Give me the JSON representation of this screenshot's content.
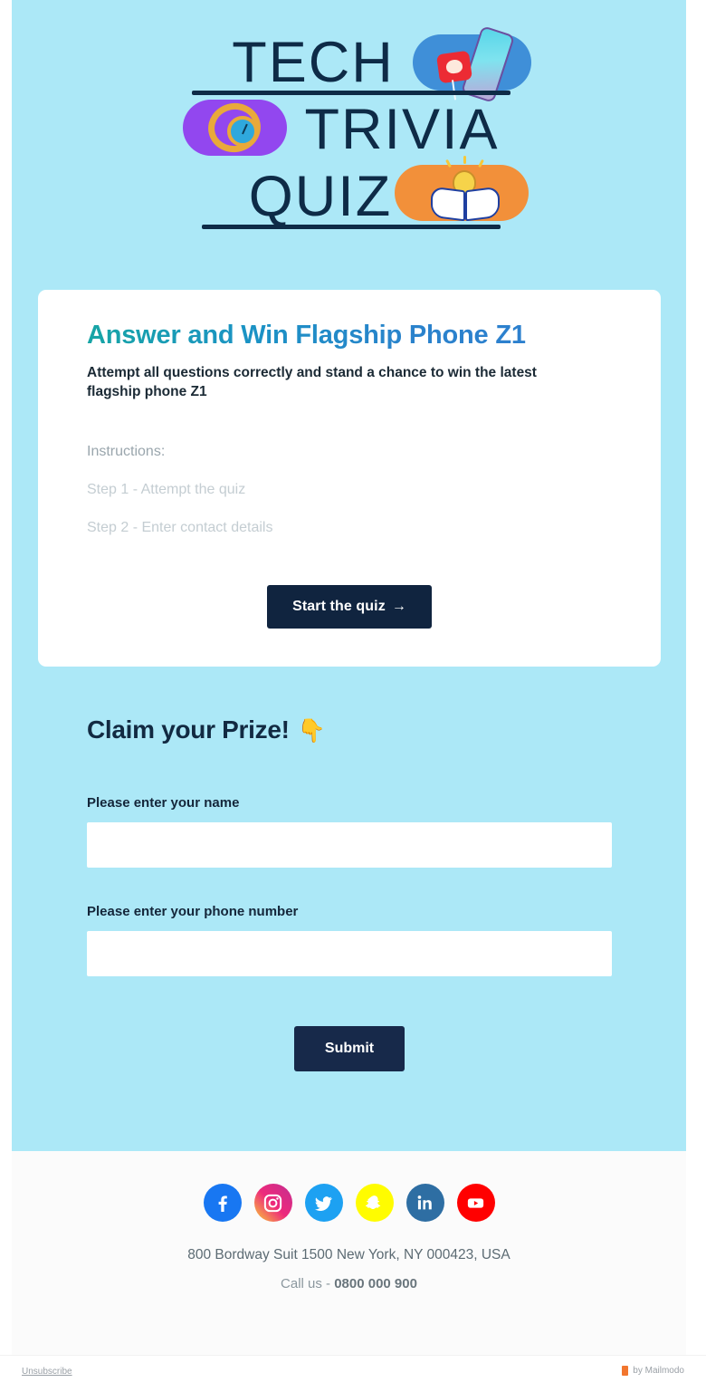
{
  "brand": {
    "logo_line_1": "TECH",
    "logo_line_2": "TRIVIA",
    "logo_line_3": "QUIZ",
    "logo_colors": {
      "text": "#0e2b47",
      "pill_phone": "#3f8fd8",
      "pill_watch": "#9247ef",
      "pill_book": "#f2903a"
    }
  },
  "theme": {
    "page_background": "#ace8f7",
    "card_background": "#ffffff",
    "accent_button": "#10243f",
    "heading_gradient_from": "#17a5a5",
    "heading_gradient_to": "#2f7fd0",
    "footer_background": "#fbfbfb"
  },
  "card": {
    "title": "Answer and Win Flagship Phone Z1",
    "subtitle": "Attempt all questions correctly and stand a chance to win the latest flagship phone Z1",
    "instructions_label": "Instructions:",
    "steps": [
      "Step 1 - Attempt the quiz",
      "Step 2 - Enter contact details"
    ],
    "cta_label": "Start the quiz",
    "cta_arrow": "→"
  },
  "claim": {
    "title": "Claim your Prize!",
    "title_emoji": "👇",
    "name_label": "Please enter your name",
    "name_value": "",
    "name_placeholder": "",
    "phone_label": "Please enter your phone number",
    "phone_value": "",
    "phone_placeholder": "",
    "submit_label": "Submit"
  },
  "footer": {
    "social": [
      {
        "name": "facebook",
        "label": "Facebook"
      },
      {
        "name": "instagram",
        "label": "Instagram"
      },
      {
        "name": "twitter",
        "label": "Twitter"
      },
      {
        "name": "snapchat",
        "label": "Snapchat"
      },
      {
        "name": "linkedin",
        "label": "LinkedIn"
      },
      {
        "name": "youtube",
        "label": "YouTube"
      }
    ],
    "address": "800 Bordway Suit 1500 New York, NY 000423, USA",
    "call_prefix": "Call us - ",
    "phone_number": "0800 000 900"
  },
  "bottom_bar": {
    "unsubscribe": "Unsubscribe",
    "made_by": "by Mailmodo"
  }
}
